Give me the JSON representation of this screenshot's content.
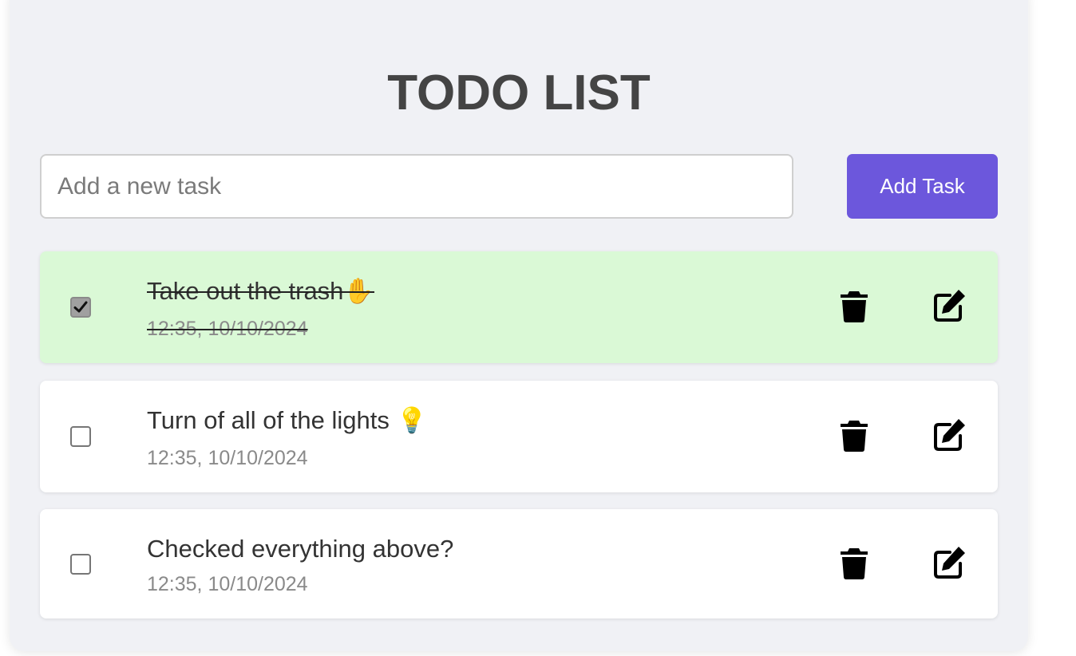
{
  "header": {
    "title": "TODO LIST"
  },
  "new_task": {
    "placeholder": "Add a new task",
    "value": ""
  },
  "add_button": {
    "label": "Add Task",
    "color": "#6c57dc"
  },
  "tasks": [
    {
      "text": "Take out the trash✋",
      "time": "12:35, 10/10/2024",
      "completed": true,
      "background": "#daf9d6",
      "delete_icon": "trash-icon",
      "edit_icon": "edit-icon"
    },
    {
      "text": "Turn of all of the lights 💡",
      "time": "12:35, 10/10/2024",
      "completed": false,
      "background": "#ffffff",
      "delete_icon": "trash-icon",
      "edit_icon": "edit-icon"
    },
    {
      "text": "Checked everything above?",
      "time": "12:35, 10/10/2024",
      "completed": false,
      "background": "#ffffff",
      "delete_icon": "trash-icon",
      "edit_icon": "edit-icon"
    }
  ]
}
